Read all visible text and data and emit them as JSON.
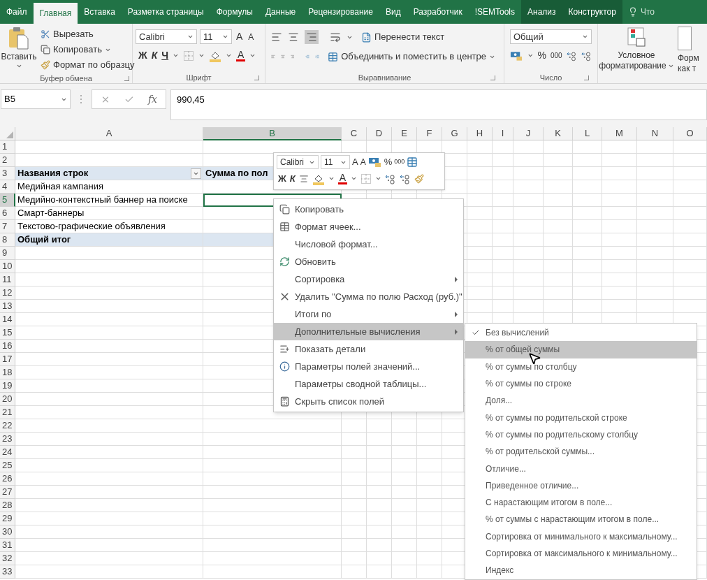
{
  "tabs": [
    {
      "label": "Файл",
      "selected": false,
      "kind": "normal"
    },
    {
      "label": "Главная",
      "selected": true,
      "kind": "normal"
    },
    {
      "label": "Вставка",
      "selected": false,
      "kind": "normal"
    },
    {
      "label": "Разметка страницы",
      "selected": false,
      "kind": "normal"
    },
    {
      "label": "Формулы",
      "selected": false,
      "kind": "normal"
    },
    {
      "label": "Данные",
      "selected": false,
      "kind": "normal"
    },
    {
      "label": "Рецензирование",
      "selected": false,
      "kind": "normal"
    },
    {
      "label": "Вид",
      "selected": false,
      "kind": "normal"
    },
    {
      "label": "Разработчик",
      "selected": false,
      "kind": "normal"
    },
    {
      "label": "!SEMTools",
      "selected": false,
      "kind": "normal"
    },
    {
      "label": "Анализ",
      "selected": false,
      "kind": "context"
    },
    {
      "label": "Конструктор",
      "selected": false,
      "kind": "context"
    }
  ],
  "tell_me": "Что",
  "ribbon": {
    "clipboard": {
      "paste": "Вставить",
      "cut": "Вырезать",
      "copy": "Копировать",
      "format_painter": "Формат по образцу",
      "label": "Буфер обмена"
    },
    "font": {
      "name": "Calibri",
      "size": "11",
      "grow": "A",
      "shrink": "A",
      "bold": "Ж",
      "italic": "К",
      "underline": "Ч",
      "font_color": "A",
      "label": "Шрифт"
    },
    "alignment": {
      "wrap": "Перенести текст",
      "merge": "Объединить и поместить в центре",
      "label": "Выравнивание"
    },
    "number": {
      "format": "Общий",
      "percent": "%",
      "thousands": "000",
      "label": "Число"
    },
    "styles": {
      "conditional": [
        "Условное",
        "форматирование"
      ],
      "format_table": [
        "Форм",
        "как т"
      ]
    }
  },
  "formula_bar": {
    "name_box": "B5",
    "fx": "fx",
    "value": "990,45"
  },
  "columns": [
    {
      "label": "A",
      "selected": false
    },
    {
      "label": "B",
      "selected": true
    },
    {
      "label": "C",
      "selected": false
    },
    {
      "label": "D",
      "selected": false
    },
    {
      "label": "E",
      "selected": false
    },
    {
      "label": "F",
      "selected": false
    },
    {
      "label": "G",
      "selected": false
    },
    {
      "label": "H",
      "selected": false
    },
    {
      "label": "I",
      "selected": false
    },
    {
      "label": "J",
      "selected": false
    },
    {
      "label": "K",
      "selected": false
    },
    {
      "label": "L",
      "selected": false
    },
    {
      "label": "M",
      "selected": false
    },
    {
      "label": "N",
      "selected": false
    },
    {
      "label": "O",
      "selected": false
    }
  ],
  "rows": [
    {
      "number": "1",
      "selected": false,
      "kind": "empty"
    },
    {
      "number": "2",
      "selected": false,
      "kind": "empty"
    },
    {
      "number": "3",
      "selected": false,
      "kind": "header",
      "cells": [
        {
          "text": "Названия строк",
          "filter": true
        },
        {
          "text": "Сумма по пол",
          "filter": false
        }
      ]
    },
    {
      "number": "4",
      "selected": false,
      "kind": "item",
      "cells": [
        {
          "text": "Медийная кампания",
          "filter": false
        }
      ]
    },
    {
      "number": "5",
      "selected": true,
      "kind": "item",
      "cells": [
        {
          "text": "Медийно-контекстный баннер на поиске",
          "filter": false
        }
      ]
    },
    {
      "number": "6",
      "selected": false,
      "kind": "item",
      "cells": [
        {
          "text": "Смарт-баннеры",
          "filter": false
        }
      ]
    },
    {
      "number": "7",
      "selected": false,
      "kind": "item",
      "cells": [
        {
          "text": "Текстово-графические объявления",
          "filter": false
        }
      ]
    },
    {
      "number": "8",
      "selected": false,
      "kind": "total",
      "cells": [
        {
          "text": "Общий итог",
          "filter": false
        }
      ]
    },
    {
      "number": "9",
      "selected": false,
      "kind": "empty"
    },
    {
      "number": "10",
      "selected": false,
      "kind": "empty"
    },
    {
      "number": "11",
      "selected": false,
      "kind": "empty"
    },
    {
      "number": "12",
      "selected": false,
      "kind": "empty"
    },
    {
      "number": "13",
      "selected": false,
      "kind": "empty"
    },
    {
      "number": "14",
      "selected": false,
      "kind": "empty"
    },
    {
      "number": "15",
      "selected": false,
      "kind": "empty"
    },
    {
      "number": "16",
      "selected": false,
      "kind": "empty"
    },
    {
      "number": "17",
      "selected": false,
      "kind": "empty"
    },
    {
      "number": "18",
      "selected": false,
      "kind": "empty"
    },
    {
      "number": "19",
      "selected": false,
      "kind": "empty"
    },
    {
      "number": "20",
      "selected": false,
      "kind": "empty"
    },
    {
      "number": "21",
      "selected": false,
      "kind": "empty"
    },
    {
      "number": "22",
      "selected": false,
      "kind": "empty"
    },
    {
      "number": "23",
      "selected": false,
      "kind": "empty"
    },
    {
      "number": "24",
      "selected": false,
      "kind": "empty"
    },
    {
      "number": "25",
      "selected": false,
      "kind": "empty"
    },
    {
      "number": "26",
      "selected": false,
      "kind": "empty"
    },
    {
      "number": "27",
      "selected": false,
      "kind": "empty"
    },
    {
      "number": "28",
      "selected": false,
      "kind": "empty"
    },
    {
      "number": "29",
      "selected": false,
      "kind": "empty"
    },
    {
      "number": "30",
      "selected": false,
      "kind": "empty"
    },
    {
      "number": "31",
      "selected": false,
      "kind": "empty"
    },
    {
      "number": "32",
      "selected": false,
      "kind": "empty"
    },
    {
      "number": "33",
      "selected": false,
      "kind": "empty"
    }
  ],
  "mini_toolbar": {
    "font": "Calibri",
    "size": "11",
    "grow": "A",
    "shrink": "A",
    "percent": "%",
    "thousands": "000",
    "bold": "Ж",
    "italic": "К",
    "font_color": "A"
  },
  "context_menu": [
    {
      "label": "Копировать",
      "submenu": false,
      "selected": false
    },
    {
      "label": "Формат ячеек...",
      "submenu": false,
      "selected": false
    },
    {
      "label": "Числовой формат...",
      "submenu": false,
      "selected": false
    },
    {
      "label": "Обновить",
      "submenu": false,
      "selected": false
    },
    {
      "label": "Сортировка",
      "submenu": true,
      "selected": false
    },
    {
      "label": "Удалить \"Сумма по полю Расход (руб.)\"",
      "submenu": false,
      "selected": false
    },
    {
      "label": "Итоги по",
      "submenu": true,
      "selected": false
    },
    {
      "label": "Дополнительные вычисления",
      "submenu": true,
      "selected": true
    },
    {
      "label": "Показать детали",
      "submenu": false,
      "selected": false
    },
    {
      "label": "Параметры полей значений...",
      "submenu": false,
      "selected": false
    },
    {
      "label": "Параметры сводной таблицы...",
      "submenu": false,
      "selected": false
    },
    {
      "label": "Скрыть список полей",
      "submenu": false,
      "selected": false
    }
  ],
  "calc_submenu": [
    {
      "label": "Без вычислений",
      "checked": true,
      "selected": false
    },
    {
      "label": "% от общей суммы",
      "checked": false,
      "selected": true
    },
    {
      "label": "% от суммы по столбцу",
      "checked": false,
      "selected": false
    },
    {
      "label": "% от суммы по строке",
      "checked": false,
      "selected": false
    },
    {
      "label": "Доля...",
      "checked": false,
      "selected": false
    },
    {
      "label": "% от суммы по родительской строке",
      "checked": false,
      "selected": false
    },
    {
      "label": "% от суммы по родительскому столбцу",
      "checked": false,
      "selected": false
    },
    {
      "label": "% от родительской суммы...",
      "checked": false,
      "selected": false
    },
    {
      "label": "Отличие...",
      "checked": false,
      "selected": false
    },
    {
      "label": "Приведенное отличие...",
      "checked": false,
      "selected": false
    },
    {
      "label": "С нарастающим итогом в поле...",
      "checked": false,
      "selected": false
    },
    {
      "label": "% от суммы с нарастающим итогом в поле...",
      "checked": false,
      "selected": false
    },
    {
      "label": "Сортировка от минимального к максимальному...",
      "checked": false,
      "selected": false
    },
    {
      "label": "Сортировка от максимального к минимальному...",
      "checked": false,
      "selected": false
    },
    {
      "label": "Индекс",
      "checked": false,
      "selected": false
    }
  ]
}
